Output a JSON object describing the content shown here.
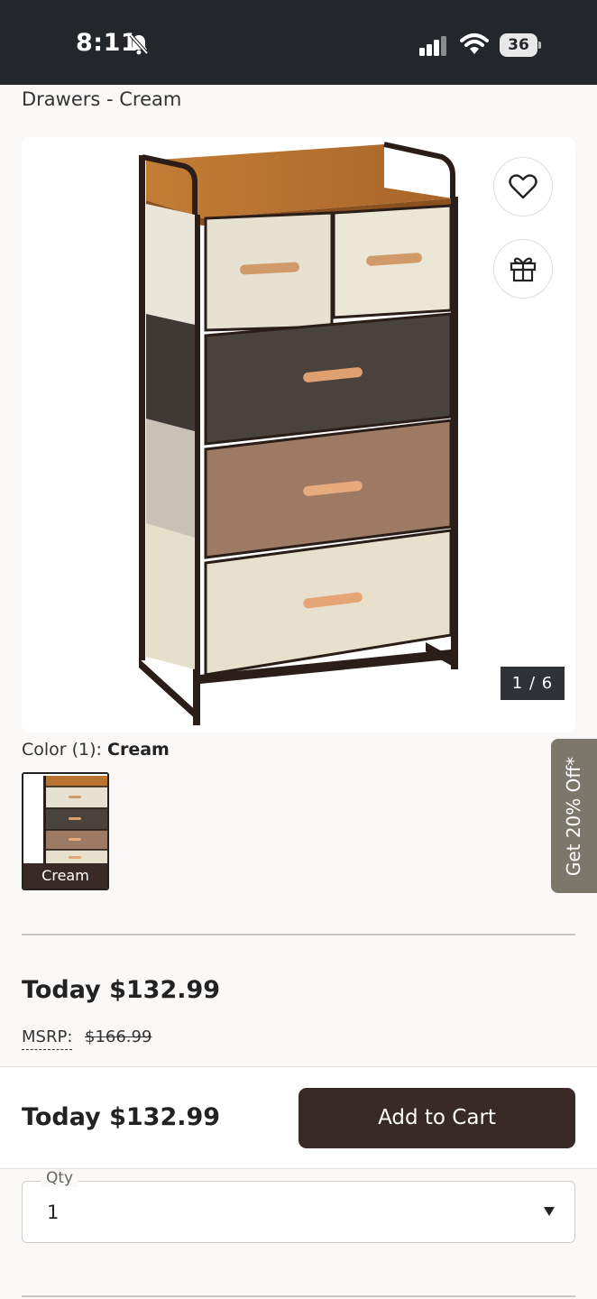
{
  "status_bar": {
    "time": "8:11",
    "battery": "36"
  },
  "product": {
    "title": "Drawers - Cream"
  },
  "gallery": {
    "counter": "1 / 6"
  },
  "color": {
    "label": "Color (1): ",
    "selected": "Cream",
    "swatch_label": "Cream"
  },
  "promo": {
    "text": "Get 20% Off*"
  },
  "pricing": {
    "today": "Today $132.99",
    "msrp_label": "MSRP:",
    "msrp_value": "$166.99"
  },
  "sticky": {
    "price": "Today $132.99",
    "add_to_cart": "Add to Cart"
  },
  "quantity": {
    "label": "Qty",
    "value": "1"
  },
  "colors": {
    "accent": "#3a2a27",
    "status_bar": "#23262b",
    "promo": "#7b786b"
  },
  "icons": {
    "bell": "bell-slash-icon",
    "wishlist": "heart-icon",
    "gift": "gift-icon"
  }
}
